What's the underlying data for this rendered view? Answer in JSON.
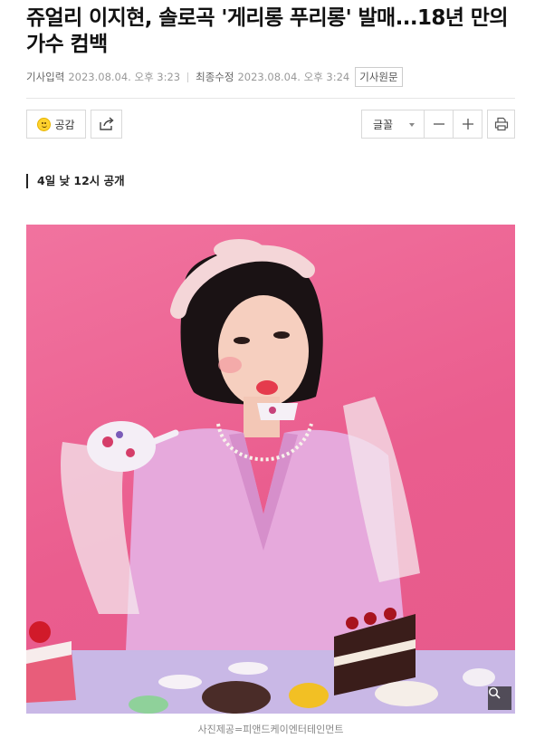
{
  "article": {
    "headline": "쥬얼리 이지현, 솔로곡 '게리롱 푸리롱' 발매...18년 만의 가수 컴백",
    "subheading": "4일 낮 12시 공개",
    "photo_caption": "사진제공=피앤드케이엔터테인먼트"
  },
  "meta": {
    "published_label": "기사입력",
    "published_time": "2023.08.04. 오후 3:23",
    "modified_label": "최종수정",
    "modified_time": "2023.08.04. 오후 3:24",
    "original_link": "기사원문"
  },
  "toolbar": {
    "like_label": "공감",
    "font_label": "글꼴",
    "icons": {
      "like": "smile-icon",
      "share": "share-icon",
      "font_dropdown": "chevron-down-icon",
      "decrease_font": "minus-icon",
      "increase_font": "plus-icon",
      "print": "print-icon",
      "zoom": "magnify-icon"
    }
  }
}
